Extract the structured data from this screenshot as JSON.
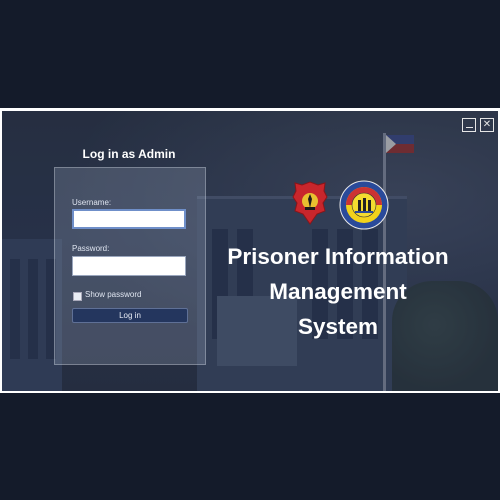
{
  "window": {
    "controls": {
      "minimize_icon": "minimize-icon",
      "close_icon": "close-icon",
      "close_glyph": "✕"
    }
  },
  "login": {
    "title": "Log in as Admin",
    "username_label": "Username:",
    "username_value": "",
    "password_label": "Password:",
    "password_value": "",
    "show_password_label": "Show password",
    "show_password_checked": false,
    "button_label": "Log in"
  },
  "app_title": {
    "line1": "Prisoner Information",
    "line2": "Management",
    "line3": "System"
  },
  "colors": {
    "button": "#24365e",
    "title_text": "#ffffff",
    "background": "#141b2a"
  }
}
